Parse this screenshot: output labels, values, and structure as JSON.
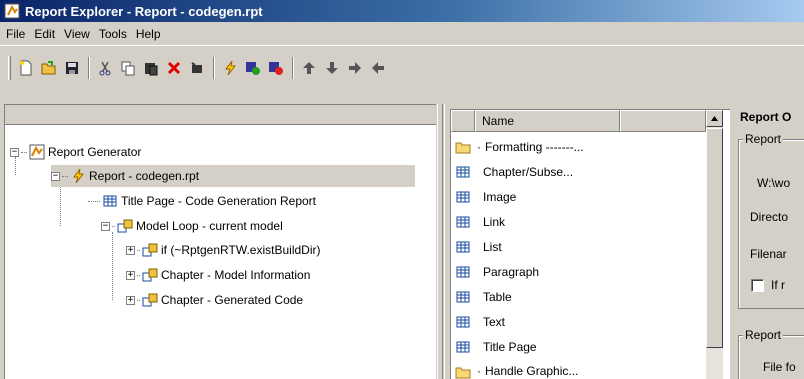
{
  "window": {
    "title": "Report Explorer - Report - codegen.rpt"
  },
  "menu": [
    "File",
    "Edit",
    "View",
    "Tools",
    "Help"
  ],
  "toolbar": {
    "buttons": [
      "new-icon",
      "open-icon",
      "save-icon",
      "cut-icon",
      "copy-icon",
      "paste-icon",
      "delete-icon",
      "run-icon",
      "report-icon",
      "apply-icon",
      "remove-icon",
      "move-up-icon",
      "move-down-icon",
      "demote-icon",
      "promote-icon"
    ]
  },
  "tree": {
    "root": "Report Generator",
    "report": "Report - codegen.rpt",
    "title_page": "Title Page - Code Generation Report",
    "model_loop": "Model Loop - current model",
    "if_item": "if (~RptgenRTW.existBuildDir)",
    "chapter_model": "Chapter - Model Information",
    "chapter_code": "Chapter - Generated Code"
  },
  "list": {
    "header": "Name",
    "items": [
      "Formatting -------...",
      "Chapter/Subse...",
      "Image",
      "Link",
      "List",
      "Paragraph",
      "Table",
      "Text",
      "Title Page",
      "Handle Graphic..."
    ]
  },
  "properties": {
    "title": "Report O",
    "group1_label": "Report",
    "path": "W:\\wo",
    "directory_label": "Directo",
    "filename_label": "Filenar",
    "checkbox_label": "If r",
    "group2_label": "Report",
    "file_format_label": "File fo"
  }
}
